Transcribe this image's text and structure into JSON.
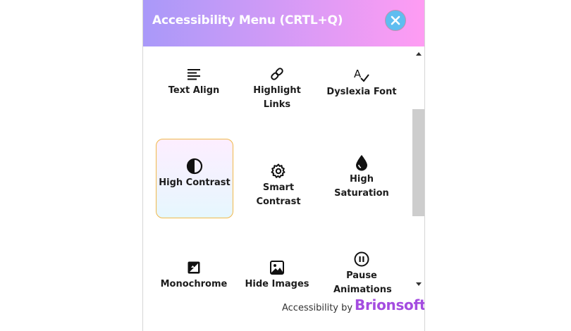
{
  "header": {
    "title": "Accessibility Menu (CRTL+Q)",
    "close_icon": "close-icon"
  },
  "tiles": [
    {
      "label": "Text Align",
      "icon": "text-align-icon",
      "active": false
    },
    {
      "label": "Highlight Links",
      "icon": "link-icon",
      "active": false
    },
    {
      "label": "Dyslexia Font",
      "icon": "dyslexia-font-icon",
      "active": false
    },
    {
      "label": "High Contrast",
      "icon": "contrast-icon",
      "active": true
    },
    {
      "label": "Smart Contrast",
      "icon": "gear-icon",
      "active": false
    },
    {
      "label": "High Saturation",
      "icon": "droplet-icon",
      "active": false
    },
    {
      "label": "Monochrome",
      "icon": "monochrome-icon",
      "active": false
    },
    {
      "label": "Hide Images",
      "icon": "image-icon",
      "active": false
    },
    {
      "label": "Pause Animations",
      "icon": "pause-icon",
      "active": false
    }
  ],
  "footer": {
    "prefix": "Accessibility by",
    "brand": "Brionsoft"
  },
  "colors": {
    "header_gradient_start": "#a999f9",
    "header_gradient_end": "#ff9cf3",
    "close_button": "#5fbdf0",
    "active_border": "#f0b84a",
    "brand": "#a44ce0"
  }
}
